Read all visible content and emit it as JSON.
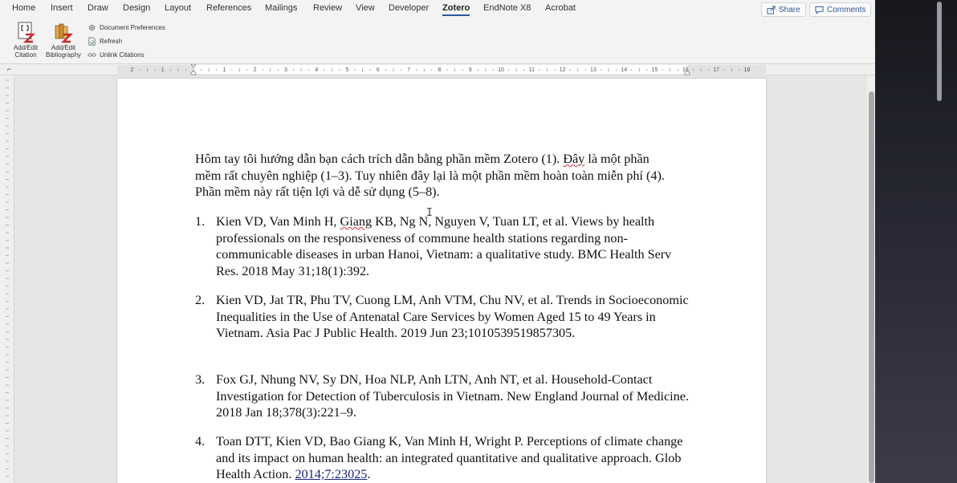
{
  "ribbon": {
    "tabs": [
      {
        "label": "Home"
      },
      {
        "label": "Insert"
      },
      {
        "label": "Draw"
      },
      {
        "label": "Design"
      },
      {
        "label": "Layout"
      },
      {
        "label": "References"
      },
      {
        "label": "Mailings"
      },
      {
        "label": "Review"
      },
      {
        "label": "View"
      },
      {
        "label": "Developer"
      },
      {
        "label": "Zotero",
        "active": true
      },
      {
        "label": "EndNote X8"
      },
      {
        "label": "Acrobat"
      }
    ],
    "share_label": "Share",
    "comments_label": "Comments",
    "accent_color": "#2b579a",
    "zotero": {
      "add_edit_citation": "Add/Edit\nCitation",
      "add_edit_bibliography": "Add/Edit\nBibliography",
      "document_preferences": "Document Preferences",
      "refresh": "Refresh",
      "unlink_citations": "Unlink Citations"
    }
  },
  "ruler": {
    "labels": [
      "2",
      "1",
      "1",
      "2",
      "3",
      "4",
      "5",
      "6",
      "7",
      "8",
      "9",
      "10",
      "11",
      "12",
      "13",
      "14",
      "15",
      "16",
      "17",
      "18"
    ]
  },
  "document": {
    "paragraph": {
      "part1": "Hôm tay tôi hướng dẫn bạn cách trích dẫn bằng phần mềm Zotero (1). ",
      "squiggle": "Đây",
      "part2": " là một phần mềm rất chuyên nghiệp (1–3). Tuy nhiên đây lại là một phần mềm hoàn toàn miễn phí (4). Phần mềm này rất tiện lợi và dễ sử dụng (5–8)."
    },
    "references": [
      {
        "num": "1.",
        "pre": "Kien VD, Van Minh H, ",
        "squiggle": "Giang",
        "post": " KB, Ng N, Nguyen V, Tuan LT, et al. Views by health professionals on the responsiveness of commune health stations regarding non-communicable diseases in urban Hanoi, Vietnam: a qualitative study. BMC Health Serv Res. 2018 May 31;18(1):392."
      },
      {
        "num": "2.",
        "text": "Kien VD, Jat TR, Phu TV, Cuong LM, Anh VTM, Chu NV, et al. Trends in Socioeconomic Inequalities in the Use of Antenatal Care Services by Women Aged 15 to 49 Years in Vietnam. Asia Pac J Public Health. 2019 Jun 23;1010539519857305."
      },
      {
        "num": "3.",
        "text": "Fox GJ, Nhung NV, Sy DN, Hoa NLP, Anh LTN, Anh NT, et al. Household-Contact Investigation for Detection of Tuberculosis in Vietnam. New England Journal of Medicine. 2018 Jan 18;378(3):221–9."
      },
      {
        "num": "4.",
        "pre": "Toan DTT, Kien VD, Bao Giang K, Van Minh H, Wright P. Perceptions of climate change and its impact on human health: an integrated quantitative and qualitative approach. Glob Health Action. ",
        "link": "2014;7:23025",
        "post": "."
      }
    ]
  }
}
